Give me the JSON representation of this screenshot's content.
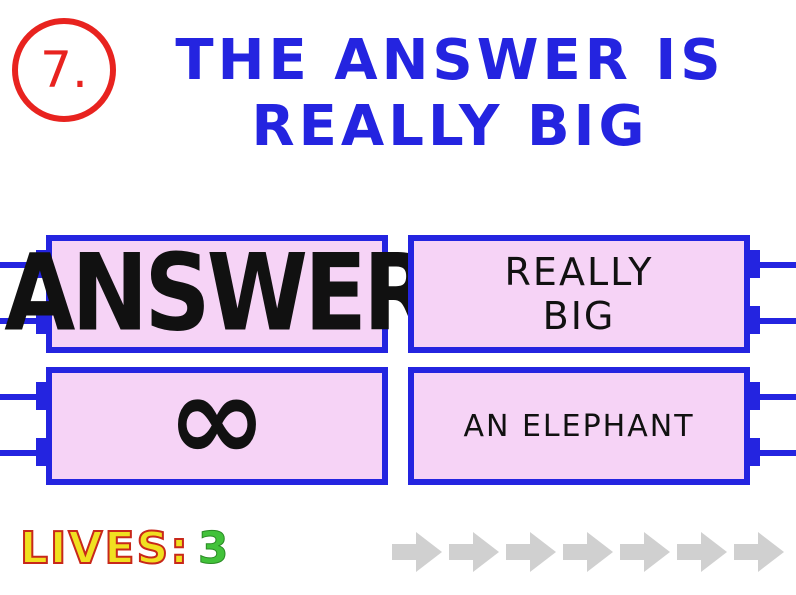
{
  "question": {
    "number": "7.",
    "text": "THE ANSWER IS REALLY BIG"
  },
  "answers": [
    {
      "label": "ANSWER"
    },
    {
      "label": "REALLY\nBIG"
    },
    {
      "label": "∞"
    },
    {
      "label": "AN ELEPHANT"
    }
  ],
  "status": {
    "lives_label": "LIVES:",
    "lives_value": "3"
  },
  "progress": {
    "arrows_total": 7,
    "arrows_filled": 0
  },
  "colors": {
    "accent_blue": "#2424e0",
    "answer_fill": "#f6d3f6",
    "number_red": "#e8231f",
    "arrow_grey": "#d0d0d0"
  }
}
